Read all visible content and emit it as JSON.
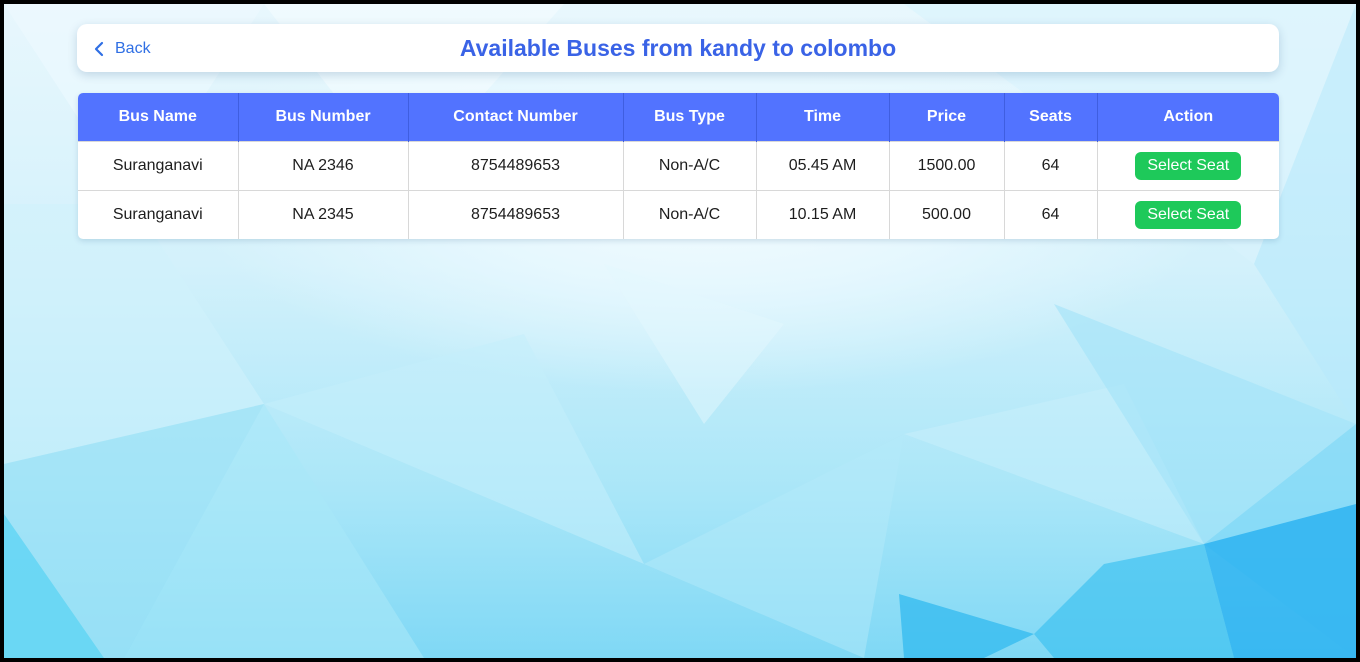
{
  "header": {
    "back_label": "Back",
    "title": "Available Buses from kandy to colombo"
  },
  "table": {
    "columns": [
      "Bus Name",
      "Bus Number",
      "Contact Number",
      "Bus Type",
      "Time",
      "Price",
      "Seats",
      "Action"
    ],
    "rows": [
      {
        "bus_name": "Suranganavi",
        "bus_number": "NA 2346",
        "contact": "8754489653",
        "bus_type": "Non-A/C",
        "time": "05.45 AM",
        "price": "1500.00",
        "seats": "64",
        "action": "Select Seat"
      },
      {
        "bus_name": "Suranganavi",
        "bus_number": "NA 2345",
        "contact": "8754489653",
        "bus_type": "Non-A/C",
        "time": "10.15 AM",
        "price": "500.00",
        "seats": "64",
        "action": "Select Seat"
      }
    ]
  },
  "colors": {
    "title": "#3a63e6",
    "header_bg": "#5273ff",
    "action_button": "#1ec95a",
    "back_link": "#2f6fe4"
  },
  "icons": {
    "back": "chevron-left-icon"
  }
}
